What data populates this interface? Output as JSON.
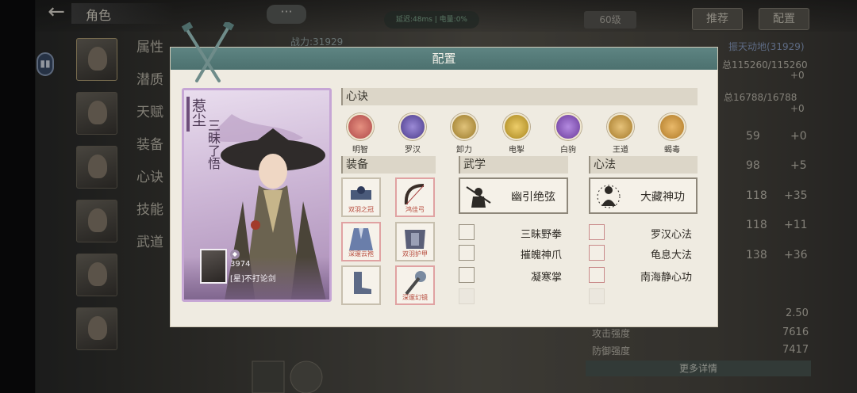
{
  "top": {
    "back_icon": "arrow-left-icon",
    "title": "角色",
    "chat_icon": "···",
    "net_status": "延迟:48ms  | 电量:0%",
    "level": "60级",
    "recommend_btn": "推荐",
    "config_btn": "配置",
    "right_subtitle": "振天动地(31929)",
    "power_label": "战力:31929"
  },
  "left_tabs": [
    "属性",
    "潜质",
    "天赋",
    "装备",
    "心诀",
    "技能",
    "武道"
  ],
  "bg_stats": {
    "hp": "总115260/115260",
    "mp": "总16788/16788",
    "plus": [
      "+0",
      "+0",
      "+0",
      "+5",
      "+35",
      "+11",
      "+36"
    ],
    "nums": [
      "59",
      "98",
      "118",
      "118",
      "138"
    ],
    "rows": [
      {
        "label": "",
        "value": "2.50"
      },
      {
        "label": "攻击强度",
        "value": "7616"
      },
      {
        "label": "防御强度",
        "value": "7417"
      }
    ],
    "more_btn": "更多详情"
  },
  "modal": {
    "title": "配置",
    "card": {
      "name": "惹尘",
      "motto": "三昧了悟",
      "power": "3974",
      "player": "[星]不打论剑"
    },
    "xinjue_header": "心诀",
    "xinjue": [
      {
        "label": "明智",
        "color": "#b04a4a",
        "icon": "brain-icon"
      },
      {
        "label": "罗汉",
        "color": "#4a3a8a",
        "icon": "monk-icon"
      },
      {
        "label": "卸力",
        "color": "#9a7a2a",
        "icon": "swirl-icon"
      },
      {
        "label": "电掣",
        "color": "#a8861e",
        "icon": "lightning-icon"
      },
      {
        "label": "白驹",
        "color": "#6a3a9a",
        "icon": "horse-icon"
      },
      {
        "label": "王道",
        "color": "#a57a2a",
        "icon": "crown-icon"
      },
      {
        "label": "蝎毒",
        "color": "#b07a28",
        "icon": "scorpion-icon"
      }
    ],
    "equip_header": "装备",
    "equip": [
      {
        "tag": "双羽之冠",
        "icon": "crown-gear-icon"
      },
      {
        "tag": "鸿佳弓",
        "icon": "bow-icon"
      },
      {
        "tag": "深邃云袍",
        "icon": "robe-icon"
      },
      {
        "tag": "双羽护甲",
        "icon": "armor-icon"
      },
      {
        "tag": "",
        "icon": "boots-icon"
      },
      {
        "tag": "深邃幻镜",
        "icon": "mace-icon"
      }
    ],
    "wuxue_header": "武学",
    "wuxue_main": "幽引绝弦",
    "wuxue": [
      "三昧野拳",
      "摧魄神爪",
      "凝寒掌",
      ""
    ],
    "xinfa_header": "心法",
    "xinfa_main": "大藏神功",
    "xinfa": [
      "罗汉心法",
      "龟息大法",
      "南海静心功",
      ""
    ]
  }
}
